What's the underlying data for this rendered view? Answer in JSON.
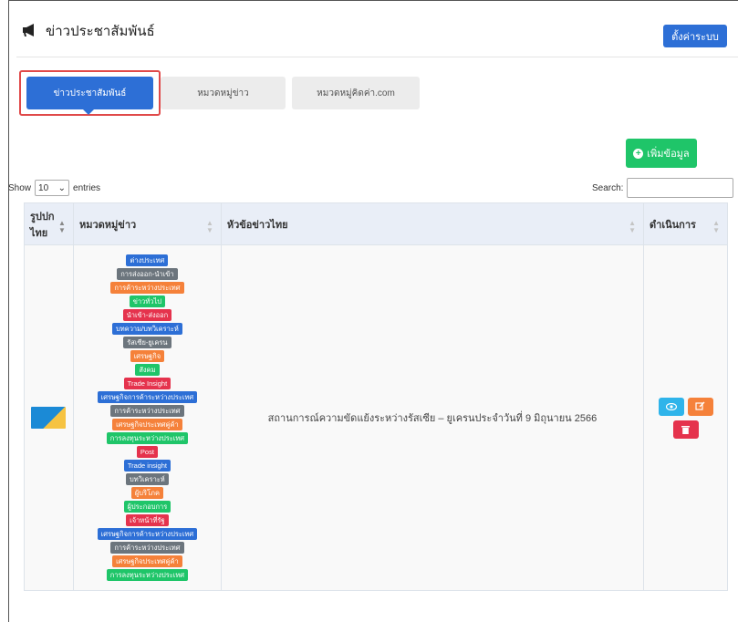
{
  "header": {
    "title": "ข่าวประชาสัมพันธ์",
    "settings_label": "ตั้งค่าระบบ"
  },
  "tabs": [
    {
      "label": "ข่าวประชาสัมพันธ์",
      "active": true
    },
    {
      "label": "หมวดหมู่ข่าว",
      "active": false
    },
    {
      "label": "หมวดหมู่คิดค่า.com",
      "active": false
    }
  ],
  "add_button": "เพิ่มข้อมูล",
  "table_controls": {
    "show_label": "Show",
    "entries_value": "10",
    "entries_label": "entries",
    "search_label": "Search:"
  },
  "columns": [
    "รูปปก ไทย",
    "หมวดหมู่ข่าว",
    "หัวข้อข่าวไทย",
    "ดำเนินการ"
  ],
  "row": {
    "categories": [
      {
        "label": "ต่างประเทศ",
        "color": "#2d6fd6"
      },
      {
        "label": "การส่งออก-นำเข้า",
        "color": "#6c757d"
      },
      {
        "label": "การค้าระหว่างประเทศ",
        "color": "#f5813a"
      },
      {
        "label": "ข่าวทั่วไป",
        "color": "#1fc569"
      },
      {
        "label": "นำเข้า-ส่งออก",
        "color": "#e5334d"
      },
      {
        "label": "บทความ/บทวิเคราะห์",
        "color": "#2d6fd6"
      },
      {
        "label": "รัสเซีย-ยูเครน",
        "color": "#6c757d"
      },
      {
        "label": "เศรษฐกิจ",
        "color": "#f5813a"
      },
      {
        "label": "สังคม",
        "color": "#1fc569"
      },
      {
        "label": "Trade Insight",
        "color": "#e5334d"
      },
      {
        "label": "เศรษฐกิจการค้าระหว่างประเทศ",
        "color": "#2d6fd6"
      },
      {
        "label": "การค้าระหว่างประเทศ",
        "color": "#6c757d"
      },
      {
        "label": "เศรษฐกิจประเทศคู่ค้า",
        "color": "#f5813a"
      },
      {
        "label": "การลงทุนระหว่างประเทศ",
        "color": "#1fc569"
      },
      {
        "label": "Post",
        "color": "#e5334d"
      },
      {
        "label": "Trade insight",
        "color": "#2d6fd6"
      },
      {
        "label": "บทวิเคราะห์",
        "color": "#6c757d"
      },
      {
        "label": "ผู้บริโภค",
        "color": "#f5813a"
      },
      {
        "label": "ผู้ประกอบการ",
        "color": "#1fc569"
      },
      {
        "label": "เจ้าหน้าที่รัฐ",
        "color": "#e5334d"
      },
      {
        "label": "เศรษฐกิจการค้าระหว่างประเทศ",
        "color": "#2d6fd6"
      },
      {
        "label": "การค้าระหว่างประเทศ",
        "color": "#6c757d"
      },
      {
        "label": "เศรษฐกิจประเทศคู่ค้า",
        "color": "#f5813a"
      },
      {
        "label": "การลงทุนระหว่างประเทศ",
        "color": "#1fc569"
      }
    ],
    "headline": "สถานการณ์ความขัดแย้งระหว่างรัสเซีย – ยูเครนประจำวันที่ 9 มิถุนายน 2566",
    "actions": [
      "view-icon",
      "edit-icon",
      "delete-icon"
    ]
  }
}
